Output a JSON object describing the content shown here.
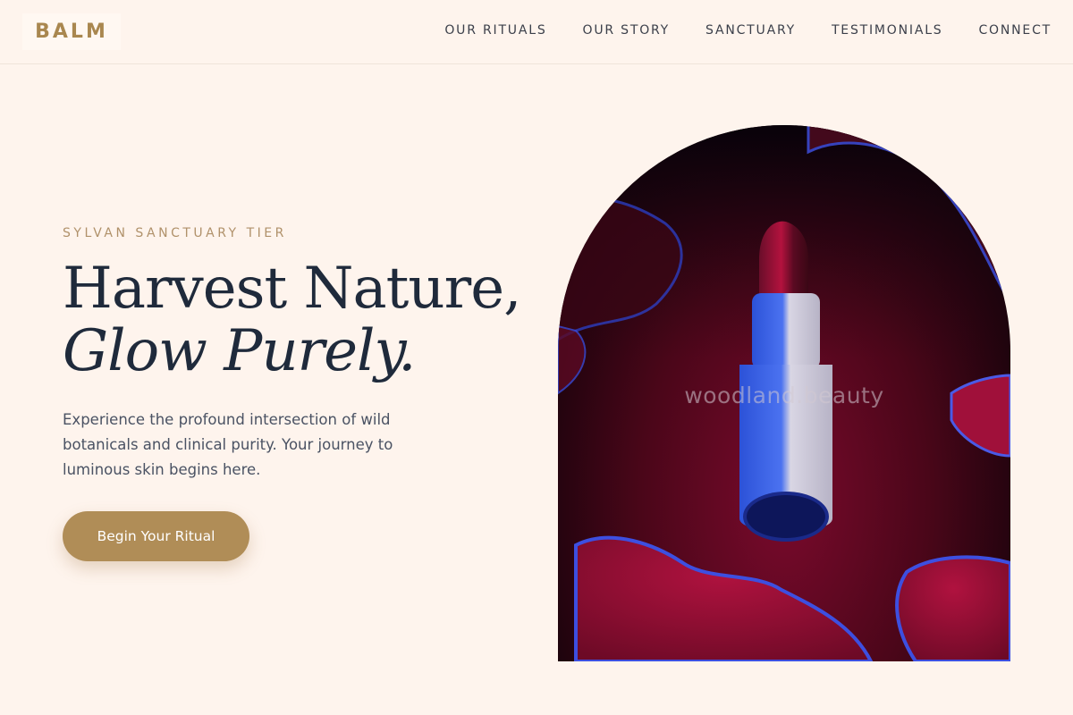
{
  "brand": {
    "logo_text": "BALM",
    "accent_color": "#b08d57",
    "background_color": "#fef4ed",
    "heading_color": "#1f2a3b"
  },
  "nav": {
    "items": [
      {
        "label": "OUR RITUALS"
      },
      {
        "label": "OUR STORY"
      },
      {
        "label": "SANCTUARY"
      },
      {
        "label": "TESTIMONIALS"
      },
      {
        "label": "CONNECT"
      }
    ]
  },
  "hero": {
    "eyebrow": "SYLVAN SANCTUARY TIER",
    "headline_line1": "Harvest Nature,",
    "headline_line2": "Glow Purely.",
    "lead": "Experience the profound intersection of wild botanicals and clinical purity. Your journey to luminous skin begins here.",
    "cta_label": "Begin Your Ritual",
    "image": {
      "subject": "lipstick-photo",
      "watermark": "woodland.beauty"
    }
  }
}
